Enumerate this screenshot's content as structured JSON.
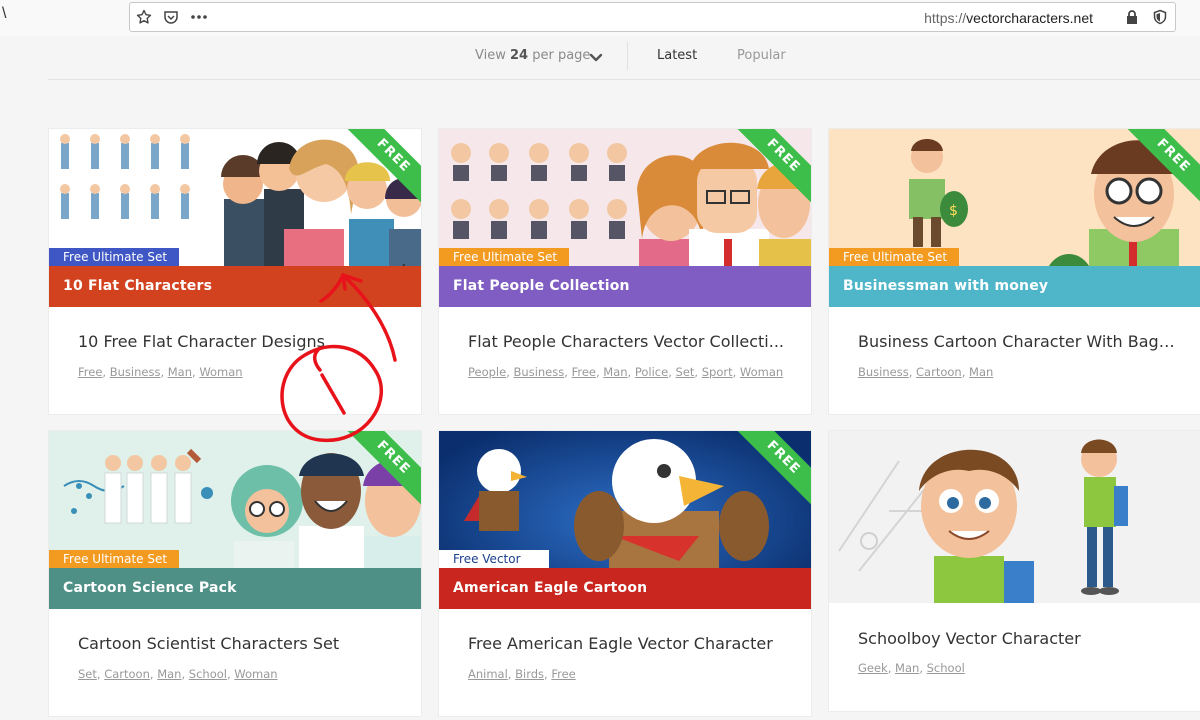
{
  "browser": {
    "left_glyph": "\\",
    "url_scheme": "https://",
    "url_host": "vectorcharacters.net"
  },
  "filter": {
    "per_page_prefix": "View",
    "per_page_value": "24",
    "per_page_suffix": "per page",
    "tab_latest": "Latest",
    "tab_popular": "Popular"
  },
  "cards": [
    {
      "badge": "Free Ultimate Set",
      "band": "10 Flat Characters",
      "ribbon": "FREE",
      "title": "10 Free Flat Character Designs",
      "tags": [
        "Free",
        "Business",
        "Man",
        "Woman"
      ]
    },
    {
      "badge": "Free Ultimate Set",
      "band": "Flat People Collection",
      "ribbon": "FREE",
      "title": "Flat People Characters Vector Collecti...",
      "tags": [
        "People",
        "Business",
        "Free",
        "Man",
        "Police",
        "Set",
        "Sport",
        "Woman"
      ]
    },
    {
      "badge": "Free Ultimate Set",
      "band": "Businessman with money",
      "ribbon": "FREE",
      "title": "Business Cartoon Character With Bag ...",
      "tags": [
        "Business",
        "Cartoon",
        "Man"
      ]
    },
    {
      "badge": "Free Ultimate Set",
      "band": "Cartoon Science Pack",
      "ribbon": "FREE",
      "title": "Cartoon Scientist Characters Set",
      "tags": [
        "Set",
        "Cartoon",
        "Man",
        "School",
        "Woman"
      ]
    },
    {
      "badge": "Free Vector",
      "band": "American Eagle Cartoon",
      "ribbon": "FREE",
      "title": "Free American Eagle Vector Character",
      "tags": [
        "Animal",
        "Birds",
        "Free"
      ]
    },
    {
      "title": "Schoolboy Vector Character",
      "tags": [
        "Geek",
        "Man",
        "School"
      ]
    }
  ],
  "colors": {
    "ribbon_green": "#3dbd4a",
    "annotation_red": "#e8121a"
  }
}
